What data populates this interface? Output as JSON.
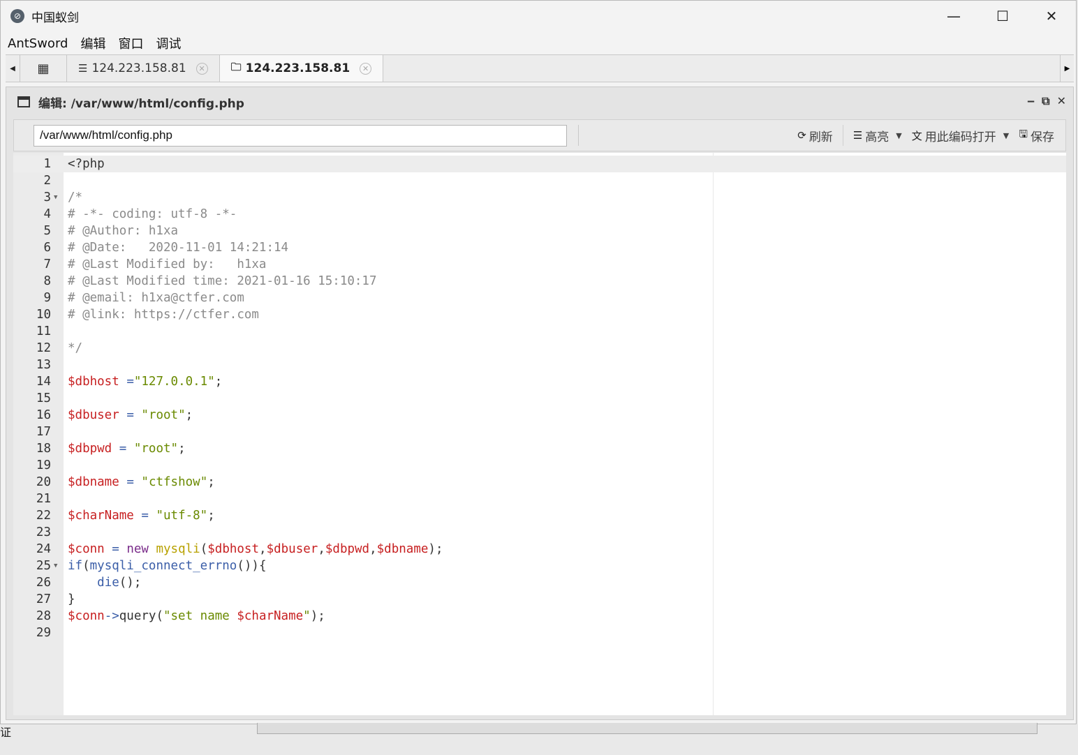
{
  "window": {
    "title": "中国蚁剑",
    "icon": "antsword-logo-icon"
  },
  "menu": [
    "AntSword",
    "编辑",
    "窗口",
    "调试"
  ],
  "tabs": [
    {
      "icon": "grid-icon",
      "label": ""
    },
    {
      "icon": "database-icon",
      "label": "124.223.158.81"
    },
    {
      "icon": "folder-icon",
      "label": "124.223.158.81"
    }
  ],
  "panel": {
    "title": "编辑: /var/www/html/config.php"
  },
  "toolbar": {
    "path_value": "/var/www/html/config.php",
    "refresh_label": "刷新",
    "highlight_label": "高亮",
    "encoding_label": "用此编码打开",
    "save_label": "保存"
  },
  "code": {
    "language": "php",
    "lines": [
      "<?php",
      "",
      "/*",
      "# -*- coding: utf-8 -*-",
      "# @Author: h1xa",
      "# @Date:   2020-11-01 14:21:14",
      "# @Last Modified by:   h1xa",
      "# @Last Modified time: 2021-01-16 15:10:17",
      "# @email: h1xa@ctfer.com",
      "# @link: https://ctfer.com",
      "",
      "*/",
      "",
      "$dbhost =\"127.0.0.1\";",
      "",
      "$dbuser = \"root\";",
      "",
      "$dbpwd = \"root\";",
      "",
      "$dbname = \"ctfshow\";",
      "",
      "$charName = \"utf-8\";",
      "",
      "$conn = new mysqli($dbhost,$dbuser,$dbpwd,$dbname);",
      "if(mysqli_connect_errno()){",
      "    die();",
      "}",
      "$conn->query(\"set name $charName\");",
      ""
    ]
  },
  "edge_text": "证"
}
